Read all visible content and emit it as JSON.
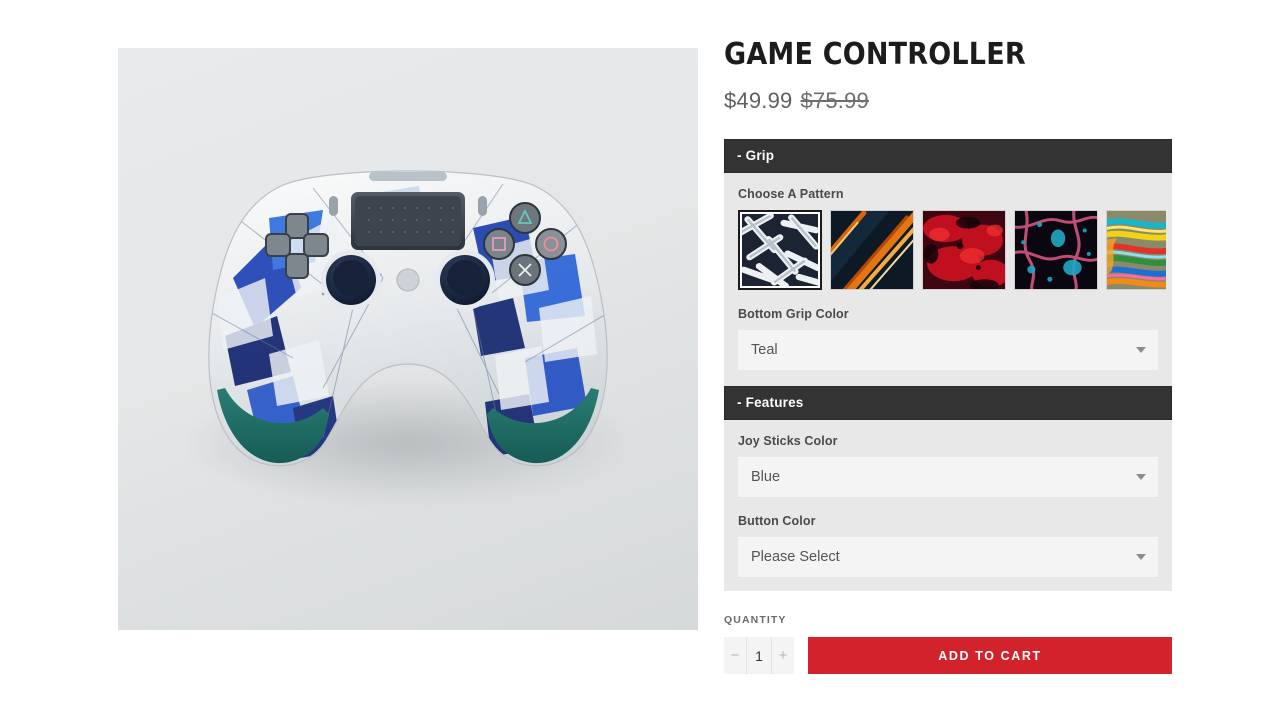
{
  "product": {
    "title": "Game Controller",
    "price_sale": "$49.99",
    "price_compare": "$75.99"
  },
  "colors": {
    "accent_red": "#d2232c",
    "section_header_bg": "#333333",
    "panel_bg": "#e8e8e8",
    "select_bg": "#f4f4f4",
    "grip_teal": "#1f6f68"
  },
  "sections": [
    {
      "header": "- Grip",
      "pattern_label": "Choose A Pattern",
      "patterns": [
        {
          "name": "white-mesh-lattice",
          "selected": true
        },
        {
          "name": "orange-fiber-streaks",
          "selected": false
        },
        {
          "name": "red-marble-ink",
          "selected": false
        },
        {
          "name": "pink-cyan-cells",
          "selected": false
        },
        {
          "name": "rainbow-oil-swirl",
          "selected": false
        }
      ],
      "fields": [
        {
          "label": "Bottom Grip Color",
          "value": "Teal"
        }
      ]
    },
    {
      "header": "- Features",
      "fields": [
        {
          "label": "Joy Sticks Color",
          "value": "Blue"
        },
        {
          "label": "Button Color",
          "value": "Please Select"
        }
      ]
    }
  ],
  "purchase": {
    "quantity_label": "Quantity",
    "quantity_value": "1",
    "decrement": "−",
    "increment": "+",
    "add_to_cart": "Add to Cart"
  },
  "gallery": {
    "alt": "white and blue geometric camo game controller with teal grips"
  }
}
